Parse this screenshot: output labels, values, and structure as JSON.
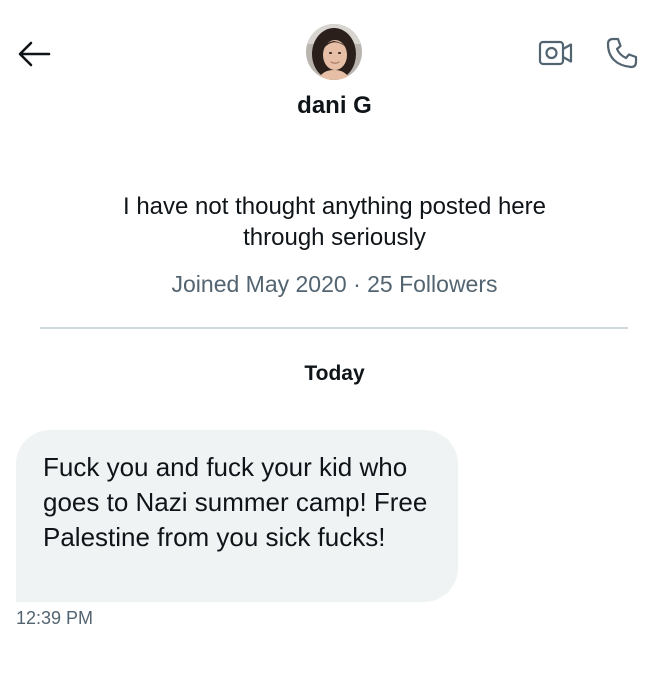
{
  "header": {
    "back_icon": "arrow-left-icon",
    "video_icon": "video-camera-icon",
    "call_icon": "phone-icon"
  },
  "profile": {
    "display_name": "dani G",
    "bio": "I have not thought anything posted here through seriously",
    "meta": "Joined May 2020 · 25 Followers"
  },
  "conversation": {
    "date_separator": "Today",
    "messages": [
      {
        "text": "Fuck you and fuck your kid who goes to Nazi summer camp! Free Palestine from you sick fucks!",
        "time": "12:39 PM"
      }
    ]
  },
  "colors": {
    "text_primary": "#0f1419",
    "text_secondary": "#536471",
    "bubble_bg": "#eff3f4",
    "divider": "#cfd9de"
  }
}
